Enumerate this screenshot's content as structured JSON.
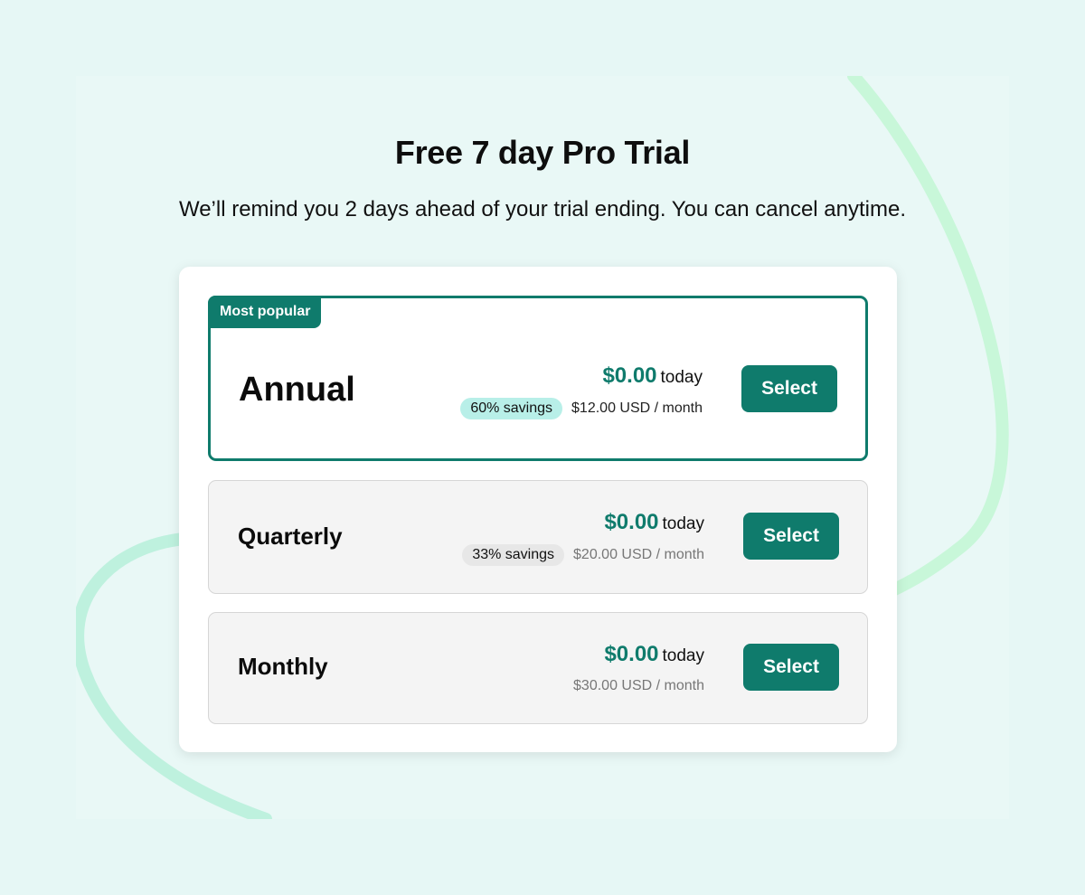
{
  "header": {
    "title": "Free 7 day Pro Trial",
    "subtitle": "We’ll remind you 2 days ahead of your trial ending. You can cancel anytime."
  },
  "colors": {
    "accent": "#0f7b6c",
    "background": "#e9f8f6",
    "badge_teal": "#b8efe8"
  },
  "plans": [
    {
      "ribbon": "Most popular",
      "name": "Annual",
      "price": "$0.00",
      "price_unit": "today",
      "savings": "60% savings",
      "monthly": "$12.00 USD / month",
      "button": "Select"
    },
    {
      "name": "Quarterly",
      "price": "$0.00",
      "price_unit": "today",
      "savings": "33% savings",
      "monthly": "$20.00 USD / month",
      "button": "Select"
    },
    {
      "name": "Monthly",
      "price": "$0.00",
      "price_unit": "today",
      "monthly": "$30.00 USD / month",
      "button": "Select"
    }
  ]
}
